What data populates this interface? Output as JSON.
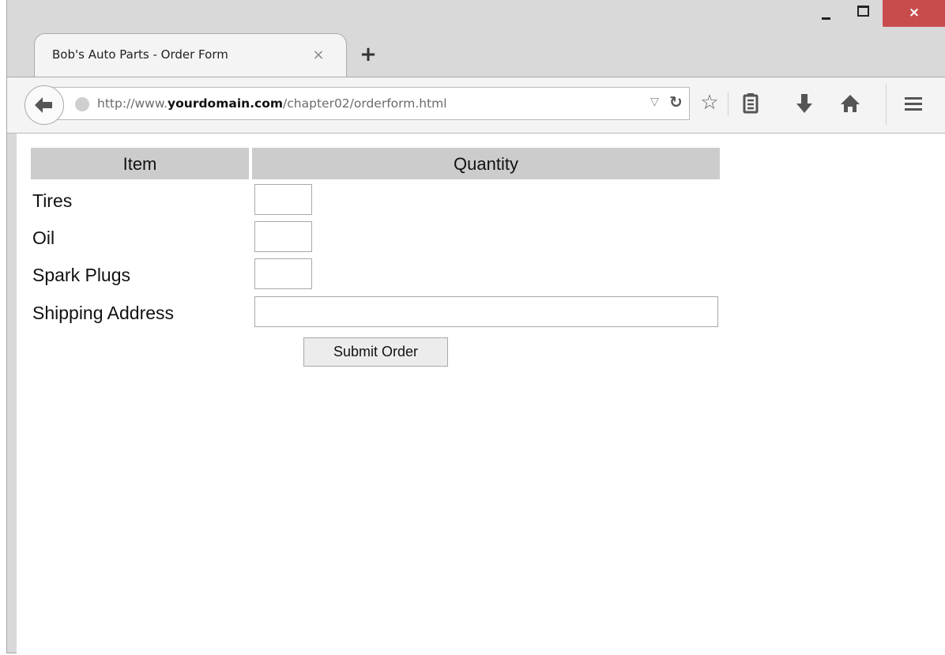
{
  "browser": {
    "tab_title": "Bob's Auto Parts - Order Form",
    "tab_close": "×",
    "new_tab": "+",
    "window_close": "×",
    "url_plain_prefix": "http://www.",
    "url_domain": "yourdomain.com",
    "url_path": "/chapter02/orderform.html",
    "icons": [
      "back-arrow-icon",
      "globe-icon",
      "dropdown-icon",
      "reload-icon",
      "bookmark-star-icon",
      "reading-list-icon",
      "download-icon",
      "home-icon",
      "menu-icon"
    ]
  },
  "form": {
    "col_item": "Item",
    "col_quantity": "Quantity",
    "rows": [
      {
        "label": "Tires",
        "value": ""
      },
      {
        "label": "Oil",
        "value": ""
      },
      {
        "label": "Spark Plugs",
        "value": ""
      }
    ],
    "address_label": "Shipping Address",
    "address_value": "",
    "submit_label": "Submit Order"
  },
  "colors": {
    "close_button": "#c94c4c",
    "header_cell": "#cccccc"
  }
}
